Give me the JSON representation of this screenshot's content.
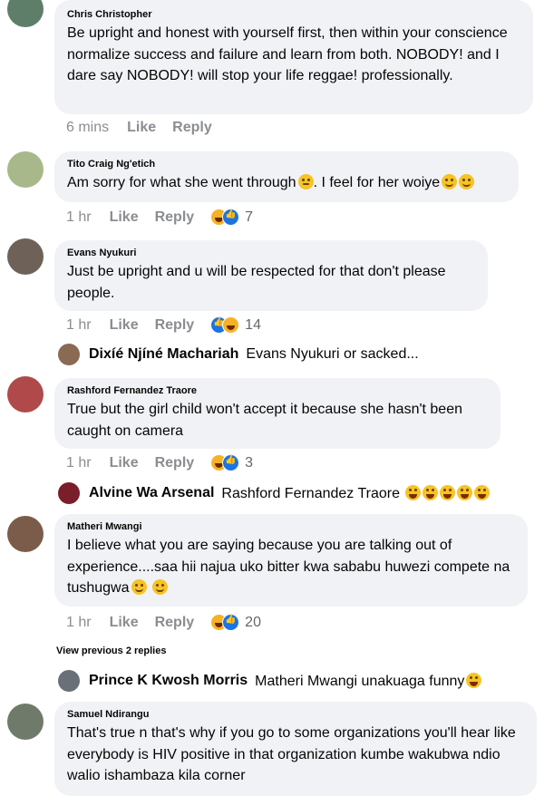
{
  "comments": [
    {
      "name": "Chris Christopher",
      "text": "Be upright and honest with yourself first, then within your conscience normalize success and failure and learn from both. NOBODY! and I dare say NOBODY! will stop your life reggae! professionally.",
      "time": "6 mins",
      "like": "Like",
      "reply": "Reply",
      "count": ""
    },
    {
      "name": "Tito Craig Ng'etich",
      "text": "Am sorry for what she went through",
      "text2": ". I feel for her woiye",
      "time": "1 hr",
      "like": "Like",
      "reply": "Reply",
      "count": "7"
    },
    {
      "name": "Evans Nyukuri",
      "text": "Just be upright and u will be respected for that don't please people.",
      "time": "1 hr",
      "like": "Like",
      "reply": "Reply",
      "count": "14"
    },
    {
      "name": "Rashford Fernandez Traore",
      "text": "True but the girl child won't accept it because she hasn't been caught on camera",
      "time": "1 hr",
      "like": "Like",
      "reply": "Reply",
      "count": "3"
    },
    {
      "name": "Matheri Mwangi",
      "text": "I believe what you are saying because you are talking out of experience....saa hii najua uko bitter kwa sababu huwezi  compete na tushugwa",
      "time": "1 hr",
      "like": "Like",
      "reply": "Reply",
      "count": "20"
    },
    {
      "name": "Samuel Ndirangu",
      "text": "That's true n that's why if you go to some organizations  you'll hear like everybody is HIV positive in that organization kumbe wakubwa ndio walio ishambaza kila corner"
    }
  ],
  "replies": [
    {
      "name": "Dixíé Njíné Machariah",
      "text": "Evans Nyukuri or sacked..."
    },
    {
      "name": "Alvine Wa Arsenal",
      "text": "Rashford Fernandez Traore"
    },
    {
      "name": "Prince K Kwosh Morris",
      "text": "Matheri Mwangi unakuaga funny"
    }
  ],
  "view_previous": "View previous 2 replies",
  "colors": {
    "bubble": "#f0f2f5",
    "meta": "#8a8d91",
    "haha": "#f7b125",
    "like": "#1b74e4"
  }
}
